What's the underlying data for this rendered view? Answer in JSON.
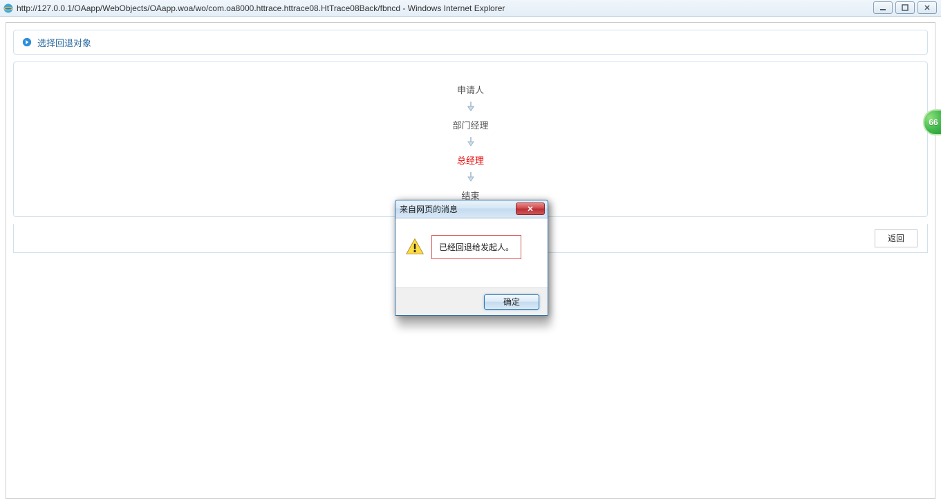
{
  "browser": {
    "url_title": "http://127.0.0.1/OAapp/WebObjects/OAapp.woa/wo/com.oa8000.httrace.httrace08.HtTrace08Back/fbncd - Windows Internet Explorer"
  },
  "panel": {
    "title": "选择回退对象"
  },
  "flow": {
    "steps": [
      "申请人",
      "部门经理",
      "总经理",
      "结束"
    ],
    "current_index": 2
  },
  "footer": {
    "return_label": "返回"
  },
  "dialog": {
    "title": "来自网页的消息",
    "message": "已经回退给发起人。",
    "ok_label": "确定",
    "close_glyph": "✕"
  },
  "side_badge": {
    "text": "66"
  }
}
